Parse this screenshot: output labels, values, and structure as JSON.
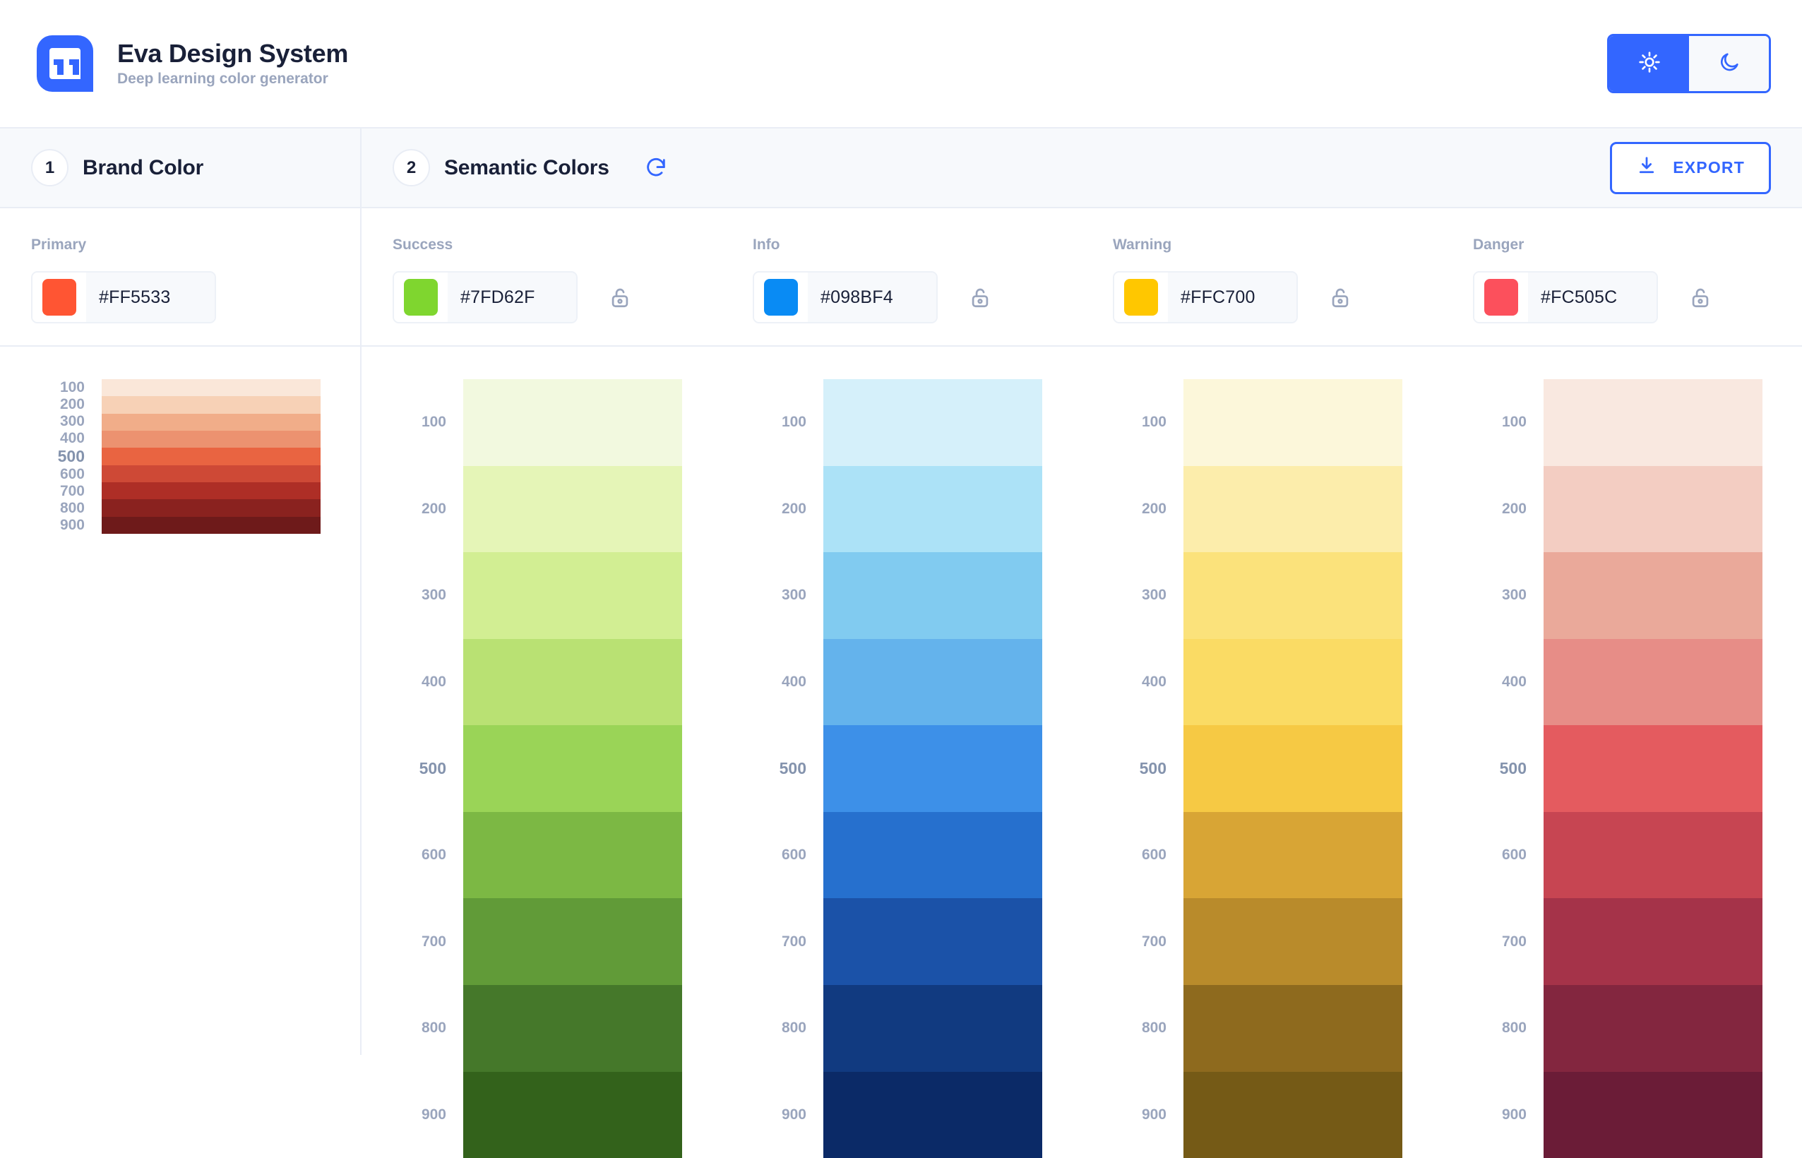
{
  "header": {
    "logo_icon": "eva-logo-icon",
    "title": "Eva Design System",
    "subtitle": "Deep learning color generator",
    "theme": {
      "light_icon": "sun-icon",
      "dark_icon": "moon-icon",
      "active": "light"
    }
  },
  "sections": {
    "brand": {
      "number": "1",
      "title": "Brand Color"
    },
    "semantic": {
      "number": "2",
      "title": "Semantic Colors",
      "refresh_icon": "refresh-icon"
    },
    "export": {
      "label": "EXPORT",
      "icon": "download-icon"
    }
  },
  "accent": "#3366FF",
  "shade_levels": [
    "100",
    "200",
    "300",
    "400",
    "500",
    "600",
    "700",
    "800",
    "900"
  ],
  "main_shade": "500",
  "lock_icon": "unlock-icon",
  "brand_colors": [
    {
      "name": "Primary",
      "hex": "#FF5533",
      "lockable": false,
      "shades": [
        "#FAE7D9",
        "#F7D1B6",
        "#F1AD89",
        "#EC9270",
        "#E96441",
        "#CE4936",
        "#AE2E26",
        "#8A221F",
        "#6E1A1A"
      ]
    }
  ],
  "semantic_colors": [
    {
      "name": "Success",
      "hex": "#7FD62F",
      "lockable": true,
      "shades": [
        "#F2F9DF",
        "#E5F5B7",
        "#D2EE93",
        "#B9E173",
        "#9AD457",
        "#7CB844",
        "#619B38",
        "#45782A",
        "#33621B"
      ]
    },
    {
      "name": "Info",
      "hex": "#098BF4",
      "lockable": true,
      "shades": [
        "#D5F0FA",
        "#ACE2F7",
        "#81CBF0",
        "#64B3EC",
        "#3D90E8",
        "#2670CE",
        "#1B52A8",
        "#113A80",
        "#0B2A67"
      ]
    },
    {
      "name": "Warning",
      "hex": "#FFC700",
      "lockable": true,
      "shades": [
        "#FCF7DA",
        "#FCEDAB",
        "#FBE27B",
        "#FADB64",
        "#F6C944",
        "#D8A535",
        "#B98B2B",
        "#8E6A1E",
        "#755A16"
      ]
    },
    {
      "name": "Danger",
      "hex": "#FC505C",
      "lockable": true,
      "shades": [
        "#F9E8E0",
        "#F3CDC2",
        "#EAA99A",
        "#E78D87",
        "#E45B5F",
        "#C74552",
        "#A53349",
        "#83263F",
        "#6B1C37"
      ]
    }
  ]
}
